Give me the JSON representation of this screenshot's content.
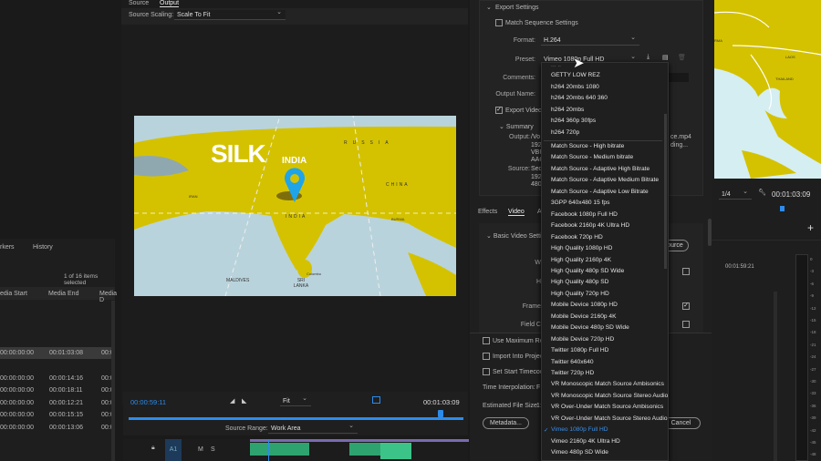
{
  "source_panel": {
    "tabs": [
      "Source",
      "Output"
    ],
    "active_tab": "Output",
    "scaling_label": "Source Scaling:",
    "scaling_value": "Scale To Fit"
  },
  "preview": {
    "title": "SILK",
    "pin_label": "INDIA",
    "labels": [
      "INDIA",
      "CHINA",
      "RUSSIA",
      "MALDIVES",
      "SRI LANKA",
      "Colombo",
      "BURMA",
      "IRAN"
    ]
  },
  "left_panel": {
    "tabs": [
      "rkers",
      "History"
    ],
    "selection_status": "1 of 16 items selected",
    "columns": [
      "edia Start",
      "Media End",
      "Media D"
    ],
    "rows": [
      [
        "00:00:00:00",
        "00:01:03:08",
        "00:0"
      ],
      [
        "00:00:00:00",
        "00:00:14:16",
        "00:0"
      ],
      [
        "00:00:00:00",
        "00:00:18:11",
        "00:0"
      ],
      [
        "00:00:00:00",
        "00:00:12:21",
        "00:0"
      ],
      [
        "00:00:00:00",
        "00:00:15:15",
        "00:0"
      ],
      [
        "00:00:00:00",
        "00:00:13:06",
        "00:0"
      ]
    ]
  },
  "timeline": {
    "current_time": "00:00:59:11",
    "fit": "Fit",
    "duration": "00:01:03:09",
    "source_range_label": "Source Range:",
    "source_range_value": "Work Area",
    "track": "A1",
    "m": "M",
    "s": "S",
    "progress": 0.94
  },
  "export": {
    "header": "Export Settings",
    "match_sequence": "Match Sequence Settings",
    "format_label": "Format:",
    "format_value": "H.264",
    "preset_label": "Preset:",
    "preset_value": "Vimeo 1080p Full HD",
    "comments_label": "Comments:",
    "output_name_label": "Output Name:",
    "export_video": "Export Video",
    "summary": "Summary",
    "output_label": "Output:",
    "output_lines": [
      "/Vo",
      "192",
      "VBR",
      "AAC"
    ],
    "output_right": [
      "ce.mp4",
      "ding..."
    ],
    "source_label": "Source:",
    "source_lines": [
      "Seq",
      "192",
      "480"
    ],
    "tabs": [
      "Effects",
      "Video",
      "A"
    ],
    "basic_video": "Basic Video Setti",
    "match_source_btn": "ource",
    "w_label": "W",
    "h_label": "H",
    "frame_label": "Frame",
    "field_label": "Field C",
    "use_max": "Use Maximum Ren",
    "import_project": "Import Into Project",
    "set_start": "Set Start Timecode",
    "time_interp_label": "Time Interpolation:",
    "time_interp_value": "F",
    "file_size_label": "Estimated File Size:",
    "file_size_value": "1:",
    "metadata_btn": "Metadata...",
    "cancel_btn": "Cancel"
  },
  "preset_menu": {
    "partial": "... ..",
    "items": [
      "GETTY LOW REZ",
      "h264 20mbs 1080",
      "h264 20mbs 640 360",
      "h264 20mbs",
      "h264 360p 30fps",
      "h264 720p",
      "Match Source - High bitrate",
      "Match Source - Medium bitrate",
      "Match Source - Adaptive High Bitrate",
      "Match Source - Adaptive Medium Bitrate",
      "Match Source - Adaptive Low Bitrate",
      "3GPP 640x480 15 fps",
      "Facebook 1080p Full HD",
      "Facebook 2160p 4K Ultra HD",
      "Facebook 720p HD",
      "High Quality 1080p HD",
      "High Quality 2160p 4K",
      "High Quality 480p SD Wide",
      "High Quality 480p SD",
      "High Quality 720p HD",
      "Mobile Device 1080p HD",
      "Mobile Device 2160p 4K",
      "Mobile Device 480p SD Wide",
      "Mobile Device 720p HD",
      "Twitter 1080p Full HD",
      "Twitter 640x640",
      "Twitter 720p HD",
      "VR Monoscopic Match Source Ambisonics",
      "VR Monoscopic Match Source Stereo Audio",
      "VR Over-Under Match Source Ambisonics",
      "VR Over-Under Match Source Stereo Audio",
      "Vimeo 1080p Full HD",
      "Vimeo 2160p 4K Ultra HD",
      "Vimeo 480p SD Wide"
    ],
    "selected": "Vimeo 1080p Full HD",
    "check": "✓"
  },
  "program": {
    "map_labels": [
      "RMA",
      "LAOS",
      "THAILAND"
    ],
    "zoom": "1/4",
    "timecode": "00:01:03:09",
    "plus": "+",
    "seq_time": "00:01:59:21",
    "meter_scale": [
      "0",
      "-3",
      "-6",
      "-9",
      "-12",
      "-15",
      "-18",
      "-21",
      "-24",
      "-27",
      "-30",
      "-33",
      "-36",
      "-39",
      "-42",
      "-45",
      "-48"
    ]
  },
  "colors": {
    "accent": "#2d8ceb",
    "map_yellow": "#d4c200",
    "sea": "#b9d3dc",
    "pin": "#1fa4e8"
  }
}
